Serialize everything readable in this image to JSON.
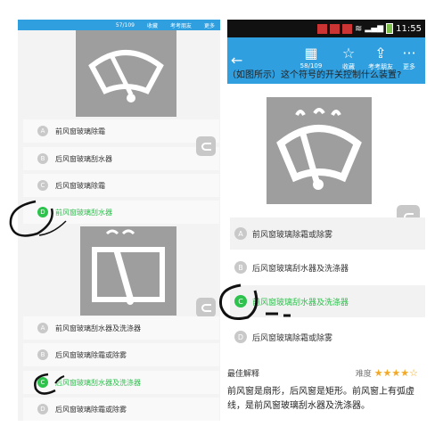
{
  "left": {
    "counter": "57/109",
    "collect": "收藏",
    "exam_friends": "考考朋友",
    "more": "更多",
    "q1_options": [
      {
        "letter": "A",
        "text": "前风窗玻璃除霜"
      },
      {
        "letter": "B",
        "text": "后风窗玻璃刮水器"
      },
      {
        "letter": "C",
        "text": "后风窗玻璃除霜"
      },
      {
        "letter": "D",
        "text": "前风窗玻璃刮水器"
      }
    ],
    "q2_options": [
      {
        "letter": "A",
        "text": "前风窗玻璃刮水器及洗涤器"
      },
      {
        "letter": "B",
        "text": "后风窗玻璃除霜或除雾"
      },
      {
        "letter": "C",
        "text": "后风窗玻璃刮水器及洗涤器"
      },
      {
        "letter": "D",
        "text": "后风窗玻璃除霜或除雾"
      }
    ]
  },
  "right": {
    "time": "11:55",
    "counter": "58/109",
    "collect": "收藏",
    "exam_friends": "考考朋友",
    "more": "更多",
    "question": "（如图所示）这个符号的开关控制什么装置?",
    "options": [
      {
        "letter": "A",
        "text": "前风窗玻璃除霜或除雾"
      },
      {
        "letter": "B",
        "text": "后风窗玻璃刮水器及洗涤器"
      },
      {
        "letter": "C",
        "text": "前风窗玻璃刮水器及洗涤器"
      },
      {
        "letter": "D",
        "text": "后风窗玻璃除霜或除雾"
      }
    ],
    "explain_title": "最佳解释",
    "difficulty_label": "难度",
    "difficulty_stars": 4,
    "explain_text": "前风窗是扇形，后风窗是矩形。前风窗上有弧虚线，是前风窗玻璃刮水器及洗涤器。"
  },
  "colors": {
    "accent": "#2f9fe0",
    "correct": "#2cc24c",
    "icon_bg": "#9e9e9e"
  }
}
